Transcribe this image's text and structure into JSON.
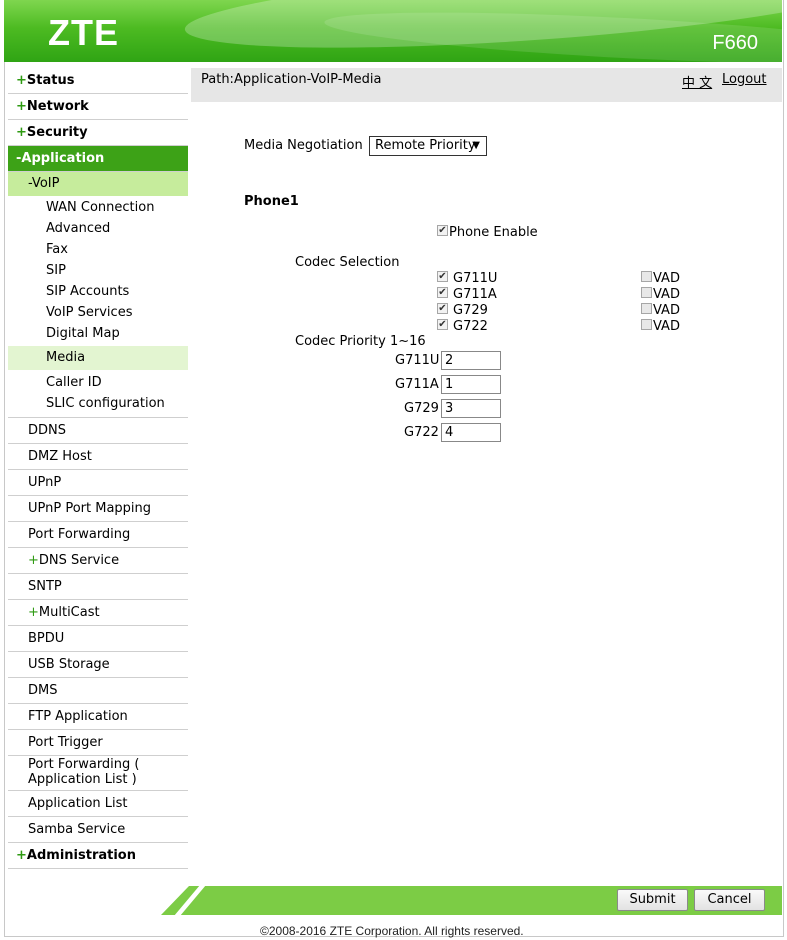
{
  "header": {
    "logo": "ZTE",
    "model": "F660",
    "brand_color": "#3da217"
  },
  "sidebar": {
    "status": "Status",
    "network": "Network",
    "security": "Security",
    "application": "-Application",
    "voip": "-VoIP",
    "voip_items": [
      "WAN Connection",
      "Advanced",
      "Fax",
      "SIP",
      "SIP Accounts",
      "VoIP Services",
      "Digital Map",
      "Media",
      "Caller ID",
      "SLIC configuration"
    ],
    "app_items": [
      "DDNS",
      "DMZ Host",
      "UPnP",
      "UPnP Port Mapping",
      "Port Forwarding",
      "DNS Service",
      "SNTP",
      "MultiCast",
      "BPDU",
      "USB Storage",
      "DMS",
      "FTP Application",
      "Port Trigger",
      "Port Forwarding (",
      "Application List )",
      "Application List",
      "Samba Service"
    ],
    "administration": "Administration"
  },
  "pathbar": {
    "path": "Path:Application-VoIP-Media",
    "lang": "中 文",
    "logout": "Logout"
  },
  "media": {
    "negotiation_label": "Media Negotiation",
    "negotiation_value": "Remote Priority",
    "phone_title": "Phone1",
    "phone_enable": "Phone Enable",
    "codec_selection": "Codec Selection",
    "codecs": [
      "G711U",
      "G711A",
      "G729",
      "G722"
    ],
    "vad": "VAD",
    "priority_label": "Codec Priority 1~16",
    "priorities": [
      "2",
      "1",
      "3",
      "4"
    ]
  },
  "footer": {
    "submit": "Submit",
    "cancel": "Cancel",
    "copyright": "©2008-2016 ZTE Corporation. All rights reserved."
  }
}
